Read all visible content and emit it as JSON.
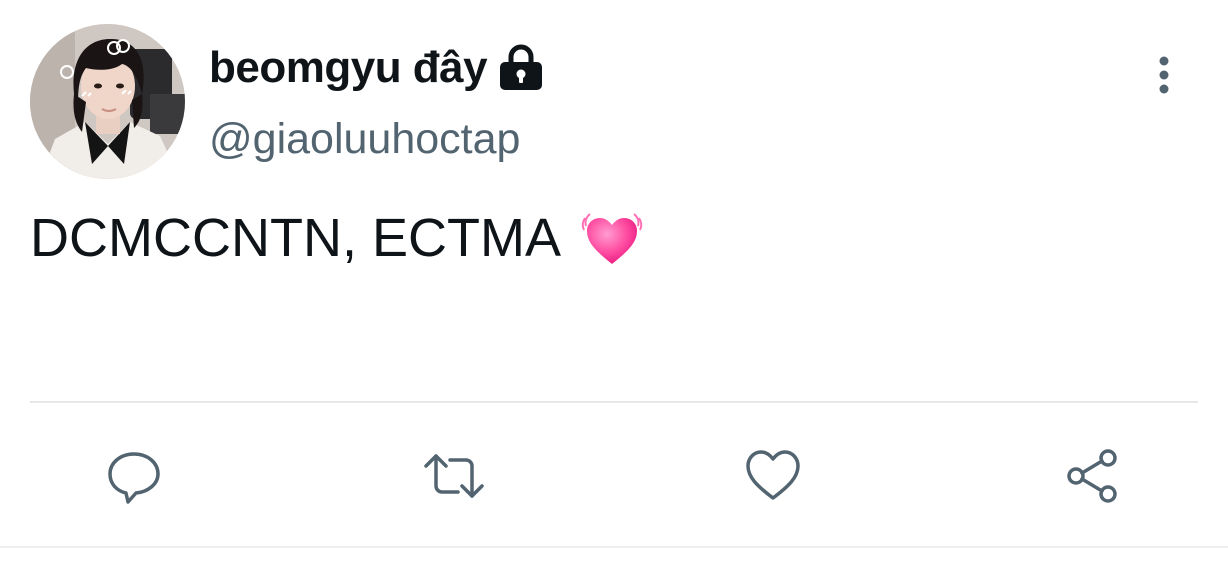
{
  "tweet": {
    "author": {
      "display_name": "beomgyu đây",
      "handle": "@giaoluuhoctap",
      "protected_icon": "lock-icon",
      "avatar": "profile-photo"
    },
    "text": "DCMCCNTN, ECTMA",
    "emoji": "vibrating-heart-emoji",
    "menu_icon": "vertical-ellipsis-icon"
  },
  "actions": [
    {
      "name": "reply",
      "icon": "speech-bubble-icon"
    },
    {
      "name": "retweet",
      "icon": "retweet-arrows-icon"
    },
    {
      "name": "like",
      "icon": "heart-outline-icon"
    },
    {
      "name": "share",
      "icon": "share-nodes-icon"
    }
  ],
  "colors": {
    "text_primary": "#0f1419",
    "text_secondary": "#536471",
    "icon": "#536471",
    "divider": "#e6e8ea",
    "heart_emoji": "#ff4fa3"
  }
}
